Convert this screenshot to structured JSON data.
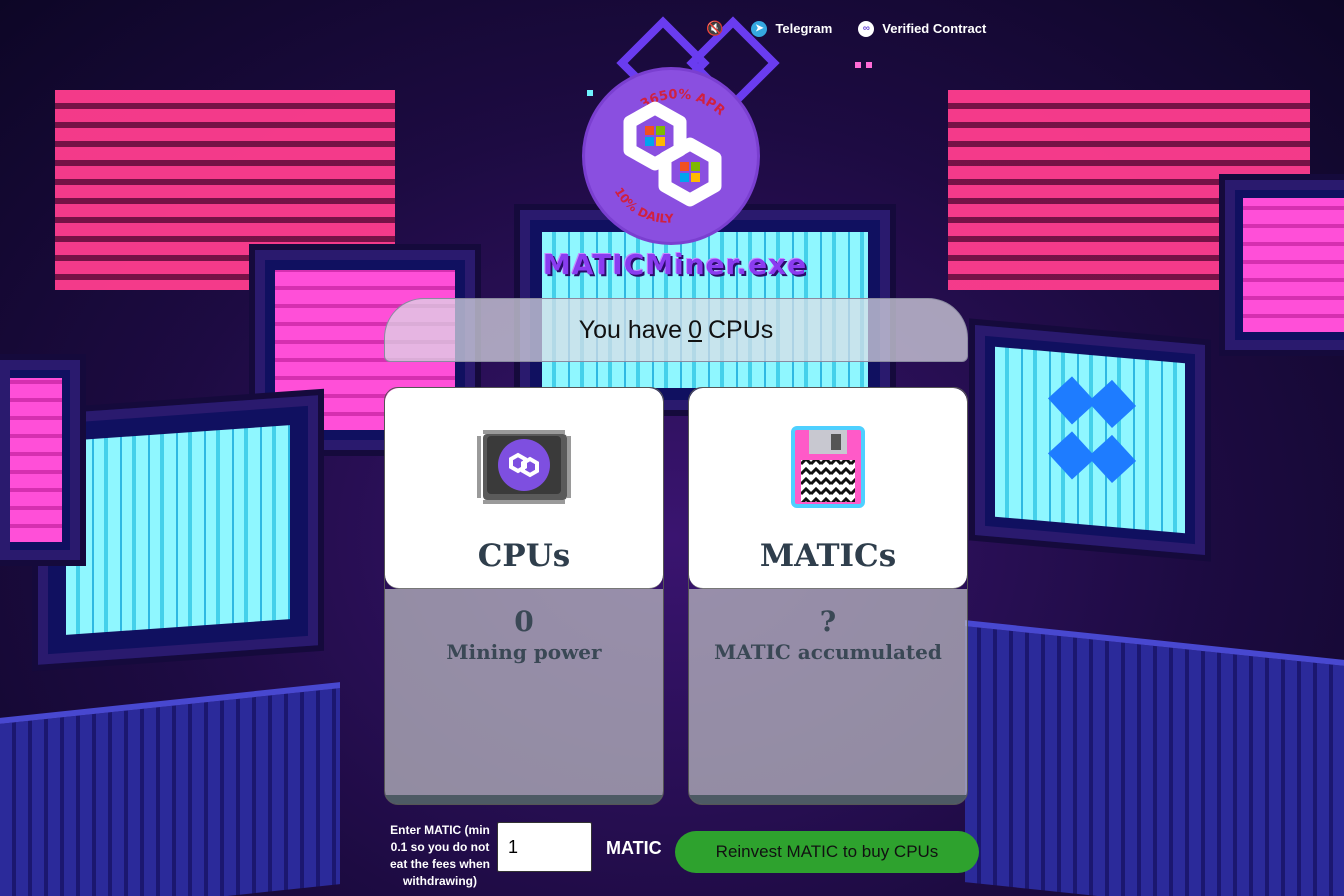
{
  "nav": {
    "mute_icon": "speaker-muted-icon",
    "telegram_label": "Telegram",
    "telegram_icon": "telegram-icon",
    "contract_label": "Verified Contract",
    "contract_icon": "polygon-icon"
  },
  "logo": {
    "apr_text": "3650% APR",
    "daily_text": "10% DAILY",
    "title": "MATICMiner.exe"
  },
  "cpu_bar": {
    "prefix": "You have",
    "count": "0",
    "suffix": "CPUs"
  },
  "cards": [
    {
      "title": "CPUs",
      "value": "0",
      "subtitle": "Mining power",
      "icon": "cpu-chip-icon"
    },
    {
      "title": "MATICs",
      "value": "?",
      "subtitle": "MATIC accumulated",
      "icon": "floppy-disk-icon"
    }
  ],
  "form": {
    "label": "Enter MATIC (min 0.1 so you do not eat the fees when withdrawing)",
    "input_value": "1",
    "unit": "MATIC",
    "reinvest_label": "Reinvest MATIC to buy CPUs"
  },
  "colors": {
    "accent_purple": "#8a4fe0",
    "button_green": "#2ea22e",
    "blind_pink": "#ff3d8e",
    "screen_cyan": "#8ff7ff"
  }
}
